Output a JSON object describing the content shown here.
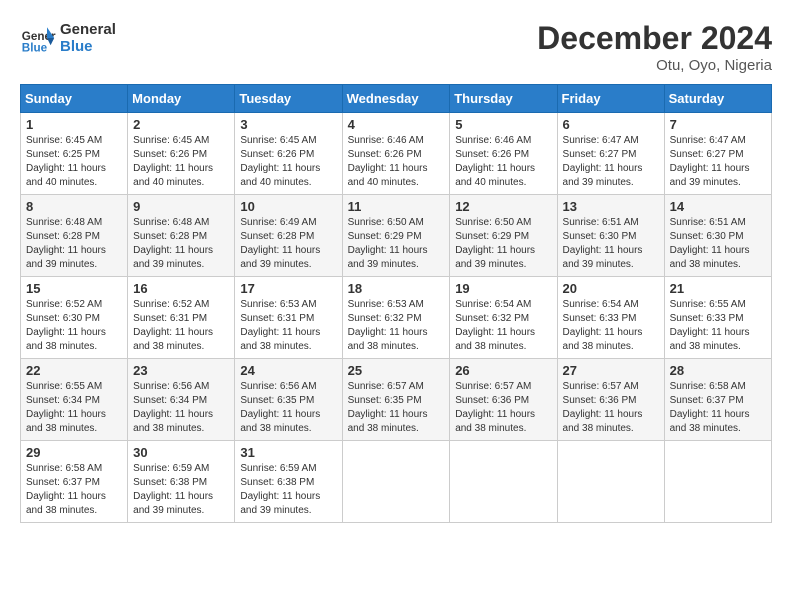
{
  "logo": {
    "text_general": "General",
    "text_blue": "Blue"
  },
  "title": "December 2024",
  "location": "Otu, Oyo, Nigeria",
  "days_of_week": [
    "Sunday",
    "Monday",
    "Tuesday",
    "Wednesday",
    "Thursday",
    "Friday",
    "Saturday"
  ],
  "weeks": [
    [
      {
        "day": "1",
        "info": "Sunrise: 6:45 AM\nSunset: 6:25 PM\nDaylight: 11 hours\nand 40 minutes."
      },
      {
        "day": "2",
        "info": "Sunrise: 6:45 AM\nSunset: 6:26 PM\nDaylight: 11 hours\nand 40 minutes."
      },
      {
        "day": "3",
        "info": "Sunrise: 6:45 AM\nSunset: 6:26 PM\nDaylight: 11 hours\nand 40 minutes."
      },
      {
        "day": "4",
        "info": "Sunrise: 6:46 AM\nSunset: 6:26 PM\nDaylight: 11 hours\nand 40 minutes."
      },
      {
        "day": "5",
        "info": "Sunrise: 6:46 AM\nSunset: 6:26 PM\nDaylight: 11 hours\nand 40 minutes."
      },
      {
        "day": "6",
        "info": "Sunrise: 6:47 AM\nSunset: 6:27 PM\nDaylight: 11 hours\nand 39 minutes."
      },
      {
        "day": "7",
        "info": "Sunrise: 6:47 AM\nSunset: 6:27 PM\nDaylight: 11 hours\nand 39 minutes."
      }
    ],
    [
      {
        "day": "8",
        "info": "Sunrise: 6:48 AM\nSunset: 6:28 PM\nDaylight: 11 hours\nand 39 minutes."
      },
      {
        "day": "9",
        "info": "Sunrise: 6:48 AM\nSunset: 6:28 PM\nDaylight: 11 hours\nand 39 minutes."
      },
      {
        "day": "10",
        "info": "Sunrise: 6:49 AM\nSunset: 6:28 PM\nDaylight: 11 hours\nand 39 minutes."
      },
      {
        "day": "11",
        "info": "Sunrise: 6:50 AM\nSunset: 6:29 PM\nDaylight: 11 hours\nand 39 minutes."
      },
      {
        "day": "12",
        "info": "Sunrise: 6:50 AM\nSunset: 6:29 PM\nDaylight: 11 hours\nand 39 minutes."
      },
      {
        "day": "13",
        "info": "Sunrise: 6:51 AM\nSunset: 6:30 PM\nDaylight: 11 hours\nand 39 minutes."
      },
      {
        "day": "14",
        "info": "Sunrise: 6:51 AM\nSunset: 6:30 PM\nDaylight: 11 hours\nand 38 minutes."
      }
    ],
    [
      {
        "day": "15",
        "info": "Sunrise: 6:52 AM\nSunset: 6:30 PM\nDaylight: 11 hours\nand 38 minutes."
      },
      {
        "day": "16",
        "info": "Sunrise: 6:52 AM\nSunset: 6:31 PM\nDaylight: 11 hours\nand 38 minutes."
      },
      {
        "day": "17",
        "info": "Sunrise: 6:53 AM\nSunset: 6:31 PM\nDaylight: 11 hours\nand 38 minutes."
      },
      {
        "day": "18",
        "info": "Sunrise: 6:53 AM\nSunset: 6:32 PM\nDaylight: 11 hours\nand 38 minutes."
      },
      {
        "day": "19",
        "info": "Sunrise: 6:54 AM\nSunset: 6:32 PM\nDaylight: 11 hours\nand 38 minutes."
      },
      {
        "day": "20",
        "info": "Sunrise: 6:54 AM\nSunset: 6:33 PM\nDaylight: 11 hours\nand 38 minutes."
      },
      {
        "day": "21",
        "info": "Sunrise: 6:55 AM\nSunset: 6:33 PM\nDaylight: 11 hours\nand 38 minutes."
      }
    ],
    [
      {
        "day": "22",
        "info": "Sunrise: 6:55 AM\nSunset: 6:34 PM\nDaylight: 11 hours\nand 38 minutes."
      },
      {
        "day": "23",
        "info": "Sunrise: 6:56 AM\nSunset: 6:34 PM\nDaylight: 11 hours\nand 38 minutes."
      },
      {
        "day": "24",
        "info": "Sunrise: 6:56 AM\nSunset: 6:35 PM\nDaylight: 11 hours\nand 38 minutes."
      },
      {
        "day": "25",
        "info": "Sunrise: 6:57 AM\nSunset: 6:35 PM\nDaylight: 11 hours\nand 38 minutes."
      },
      {
        "day": "26",
        "info": "Sunrise: 6:57 AM\nSunset: 6:36 PM\nDaylight: 11 hours\nand 38 minutes."
      },
      {
        "day": "27",
        "info": "Sunrise: 6:57 AM\nSunset: 6:36 PM\nDaylight: 11 hours\nand 38 minutes."
      },
      {
        "day": "28",
        "info": "Sunrise: 6:58 AM\nSunset: 6:37 PM\nDaylight: 11 hours\nand 38 minutes."
      }
    ],
    [
      {
        "day": "29",
        "info": "Sunrise: 6:58 AM\nSunset: 6:37 PM\nDaylight: 11 hours\nand 38 minutes."
      },
      {
        "day": "30",
        "info": "Sunrise: 6:59 AM\nSunset: 6:38 PM\nDaylight: 11 hours\nand 39 minutes."
      },
      {
        "day": "31",
        "info": "Sunrise: 6:59 AM\nSunset: 6:38 PM\nDaylight: 11 hours\nand 39 minutes."
      },
      {
        "day": "",
        "info": ""
      },
      {
        "day": "",
        "info": ""
      },
      {
        "day": "",
        "info": ""
      },
      {
        "day": "",
        "info": ""
      }
    ]
  ]
}
